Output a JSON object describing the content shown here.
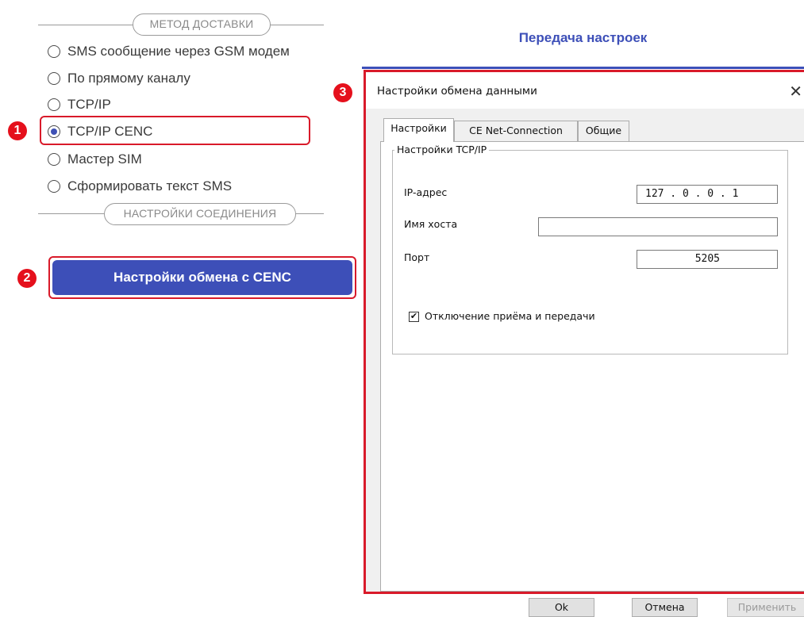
{
  "delivery_section": {
    "title": "МЕТОД ДОСТАВКИ"
  },
  "delivery_options": [
    {
      "label": "SMS сообщение через GSM модем",
      "selected": false
    },
    {
      "label": "По прямому каналу",
      "selected": false
    },
    {
      "label": "TCP/IP",
      "selected": false
    },
    {
      "label": "TCP/IP CENC",
      "selected": true
    },
    {
      "label": "Мастер SIM",
      "selected": false
    },
    {
      "label": "Сформировать текст SMS",
      "selected": false
    }
  ],
  "connection_section": {
    "title": "НАСТРОЙКИ СОЕДИНЕНИЯ"
  },
  "cenc_button": {
    "label": "Настройки обмена с CENC"
  },
  "markers": [
    "1",
    "2",
    "3"
  ],
  "header": {
    "title": "Передача настроек"
  },
  "dialog": {
    "title": "Настройки обмена данными",
    "close_glyph": "✕",
    "tabs": [
      "Настройки",
      "CE Net-Connection",
      "Общие"
    ],
    "active_tab": "Настройки",
    "group_title": "Настройки TCP/IP",
    "fields": {
      "ip": {
        "label": "IP-адрес",
        "value": "127 .  0  .  0  .  1"
      },
      "host": {
        "label": "Имя хоста",
        "value": ""
      },
      "port": {
        "label": "Порт",
        "value": "5205"
      }
    },
    "checkbox": {
      "label": "Отключение приёма и передачи",
      "checked": true,
      "glyph": "✔"
    },
    "buttons": {
      "ok": "Ok",
      "cancel": "Отмена",
      "apply": "Применить"
    }
  },
  "colors": {
    "accent": "#3d4fb8",
    "highlight": "#d91a2a",
    "marker": "#e5101c"
  }
}
